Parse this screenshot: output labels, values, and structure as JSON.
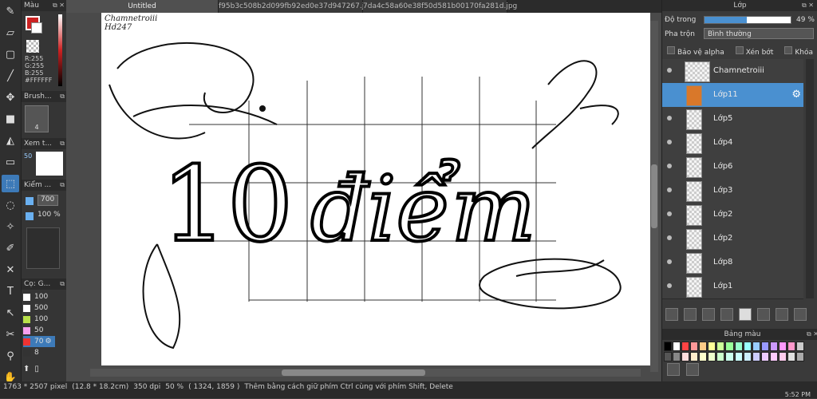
{
  "tabs": [
    {
      "label": "Untitled"
    },
    {
      "label": "f95b3c508b2d099fb92ed0e37d947267.jpg"
    },
    {
      "label": "7da4c58a60e38f50d581b00170fa281d.jpg"
    }
  ],
  "left": {
    "color_panel": {
      "title": "Màu",
      "rgb": [
        "R:255",
        "G:255",
        "B:255"
      ],
      "hex": "#FFFFFF"
    },
    "brush_panel": {
      "title": "Brush...",
      "size": "4"
    },
    "preview_panel": {
      "title": "Xem t...",
      "value": "50"
    },
    "check_panel": {
      "title": "Kiểm ...",
      "value1": "700",
      "value2": "100",
      "unit": "%"
    },
    "brush_sizes": {
      "title": "Cọ: G...",
      "items": [
        "100",
        "500",
        "100",
        "50",
        "70",
        "8"
      ]
    }
  },
  "canvas_text": {
    "author": "Chamnetroiii",
    "id": "Hd247",
    "main": "10 điểm"
  },
  "right": {
    "layer_panel_title": "Lớp",
    "opacity_label": "Độ trong",
    "opacity_value": "49 %",
    "opacity_fraction": 0.49,
    "blend_label": "Pha trộn",
    "blend_value": "Bình thường",
    "checks": [
      "Bảo vệ alpha",
      "Xén bớt",
      "Khóa"
    ],
    "layers": [
      {
        "name": "Chamnetroiii"
      },
      {
        "name": "Lớp11"
      },
      {
        "name": "Lớp5"
      },
      {
        "name": "Lớp4"
      },
      {
        "name": "Lớp6"
      },
      {
        "name": "Lớp3"
      },
      {
        "name": "Lớp2"
      },
      {
        "name": "Lớp2"
      },
      {
        "name": "Lớp8"
      },
      {
        "name": "Lớp1"
      }
    ],
    "palette_title": "Bảng màu"
  },
  "status": {
    "size": "1763 * 2507 pixel",
    "cm": "(12.8 * 18.2cm)",
    "dpi": "350 dpi",
    "zoom": "50 %",
    "coords": "( 1324, 1859 )",
    "hint": "Thêm bằng cách giữ phím Ctrl cùng với phím Shift, Delete",
    "time": "5:52 PM"
  },
  "colors": {
    "accent": "#4a90d0",
    "palette": [
      "#000000",
      "#ffffff",
      "#ff4444",
      "#ff9999",
      "#ffcc88",
      "#ffff99",
      "#ccff99",
      "#99ff99",
      "#99ffcc",
      "#99ffff",
      "#99ccff",
      "#9999ff",
      "#cc99ff",
      "#ff99ff",
      "#ff99cc",
      "#cccccc",
      "#555555",
      "#888888",
      "#ffdddd",
      "#ffeecc",
      "#ffffcc",
      "#eeffcc",
      "#ccffcc",
      "#ccffee",
      "#ccffff",
      "#cceeff",
      "#ccccff",
      "#eeccff",
      "#ffccff",
      "#ffccee",
      "#e0e0e0",
      "#aaaaaa"
    ]
  }
}
